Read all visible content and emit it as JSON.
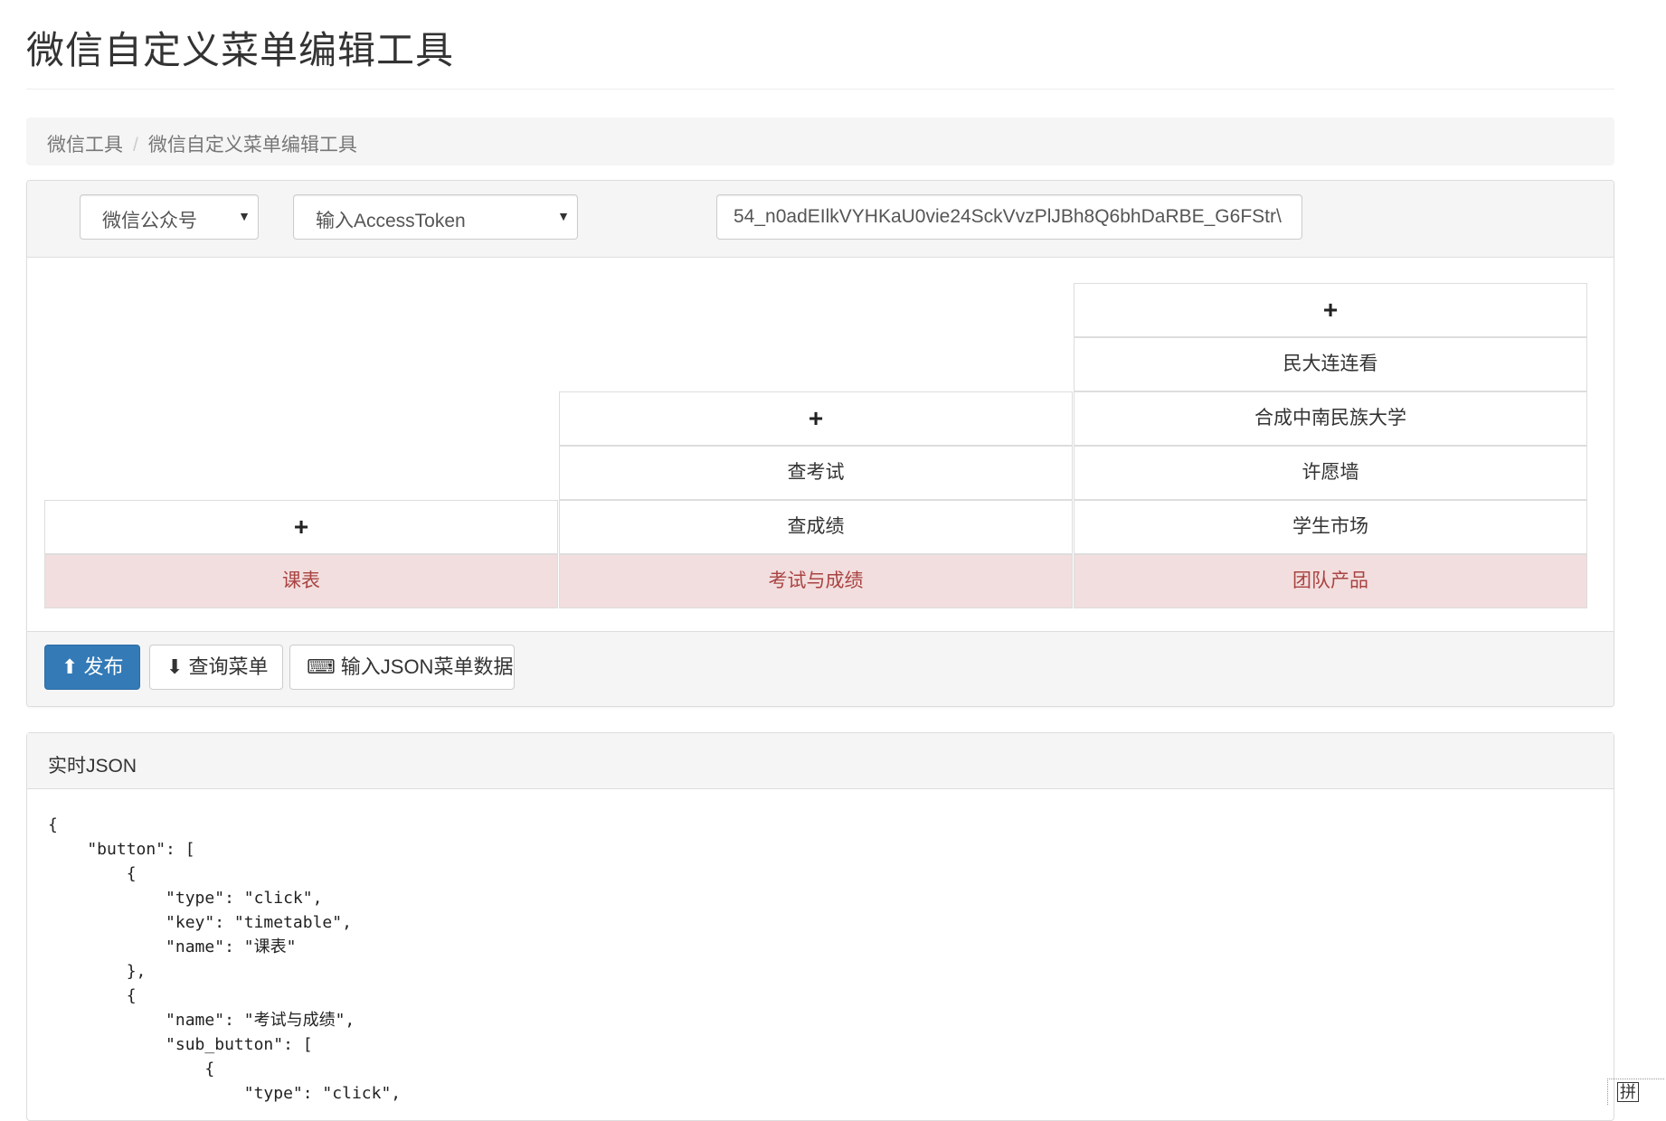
{
  "page": {
    "title": "微信自定义菜单编辑工具"
  },
  "breadcrumb": {
    "items": [
      "微信工具",
      "微信自定义菜单编辑工具"
    ],
    "separator": "/"
  },
  "controls": {
    "account_select": "微信公众号",
    "token_select": "输入AccessToken",
    "token_value": "54_n0adEIlkVYHKaU0vie24SckVvzPlJBh8Q6bhDaRBE_G6FStr\\"
  },
  "menu": {
    "plus_label": "+",
    "columns": [
      {
        "name": "课表",
        "sub": []
      },
      {
        "name": "考试与成绩",
        "sub": [
          "查考试",
          "查成绩"
        ]
      },
      {
        "name": "团队产品",
        "sub": [
          "民大连连看",
          "合成中南民族大学",
          "许愿墙",
          "学生市场"
        ]
      }
    ]
  },
  "buttons": {
    "publish": "发布",
    "query": "查询菜单",
    "input_json": "输入JSON菜单数据"
  },
  "json_panel": {
    "title": "实时JSON",
    "lines": [
      "{",
      "    \"button\": [",
      "        {",
      "            \"type\": \"click\",",
      "            \"key\": \"timetable\",",
      "            \"name\": \"课表\"",
      "        },",
      "        {",
      "            \"name\": \"考试与成绩\",",
      "            \"sub_button\": [",
      "                {",
      "                    \"type\": \"click\","
    ]
  },
  "ime": {
    "label": "拼"
  },
  "colors": {
    "primary": "#337ab7",
    "main_menu_bg": "#f2dede",
    "main_menu_text": "#a94442"
  }
}
